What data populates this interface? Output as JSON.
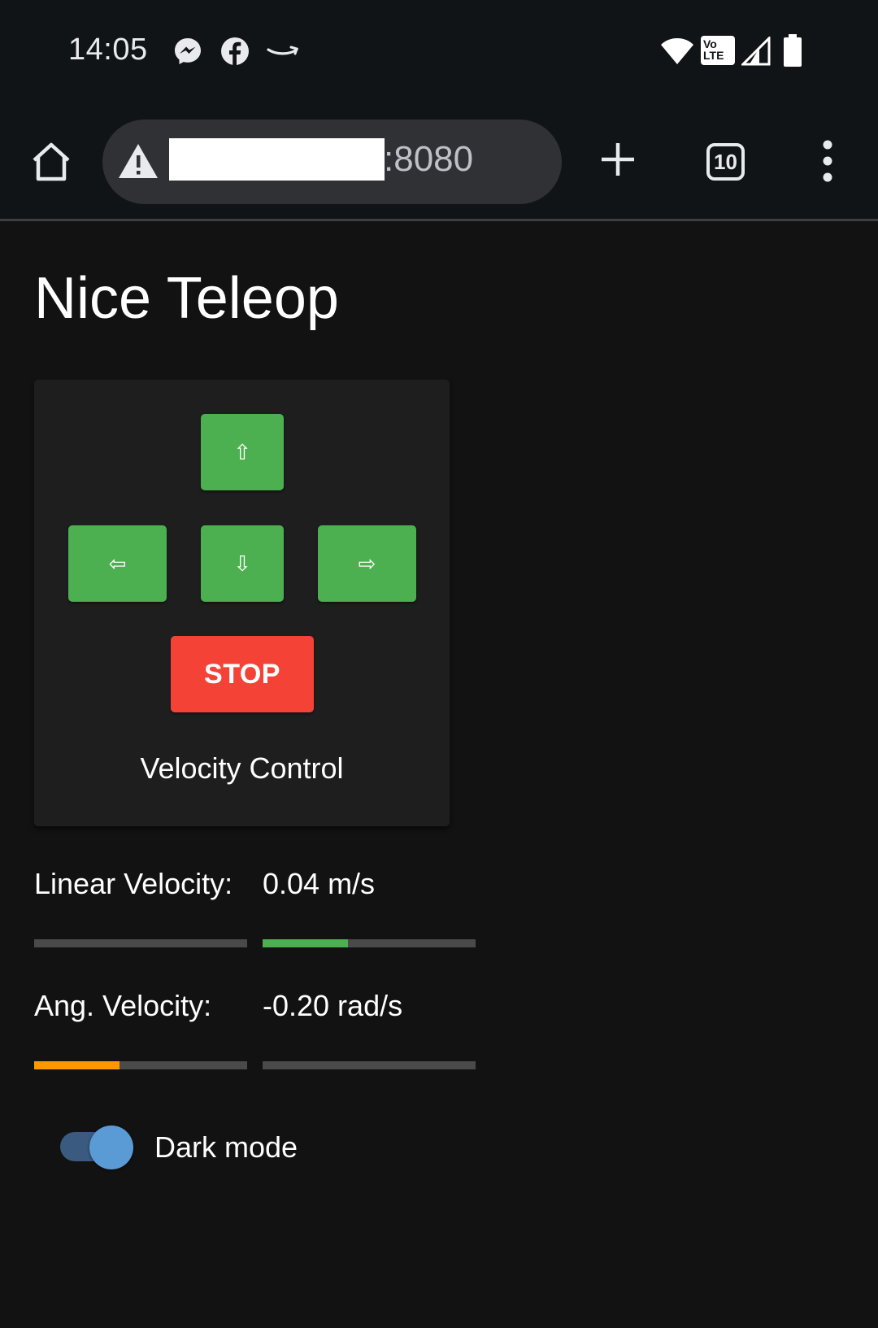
{
  "status_bar": {
    "time": "14:05",
    "notification_icons": [
      "messenger-icon",
      "facebook-icon",
      "amazon-icon"
    ],
    "system_icons": [
      "wifi-icon",
      "volte-icon",
      "signal-icon",
      "battery-icon"
    ],
    "volte_label": "Vo LTE"
  },
  "browser": {
    "url_port": ":8080",
    "tab_count": "10"
  },
  "page": {
    "title": "Nice Teleop",
    "velocity_control": {
      "up_label": "⇧",
      "left_label": "⇦",
      "down_label": "⇩",
      "right_label": "⇨",
      "stop_label": "STOP",
      "caption": "Velocity Control",
      "colors": {
        "direction_button": "#4caf50",
        "stop_button": "#f44336"
      }
    },
    "linear_velocity": {
      "label": "Linear Velocity:",
      "value": "0.04 m/s",
      "negative_fraction": 0.0,
      "positive_fraction": 0.4,
      "color": "#4caf50"
    },
    "angular_velocity": {
      "label": "Ang. Velocity:",
      "value": "-0.20 rad/s",
      "negative_fraction": 0.4,
      "positive_fraction": 0.0,
      "color": "#ff9800"
    },
    "dark_mode": {
      "label": "Dark mode",
      "enabled": true
    }
  }
}
